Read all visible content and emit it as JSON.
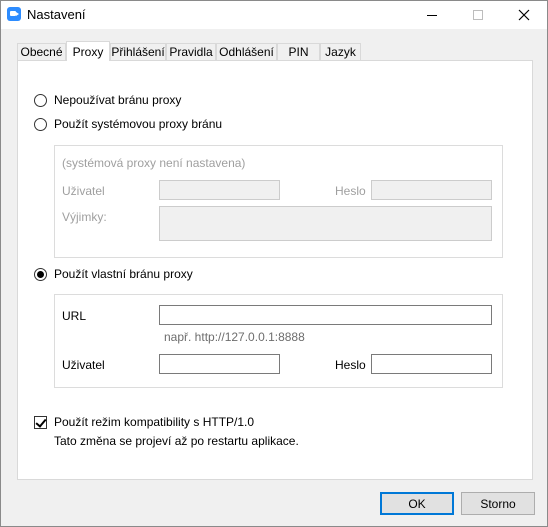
{
  "window": {
    "title": "Nastavení",
    "icon": "zoom-app-icon"
  },
  "tabs": [
    "Obecné",
    "Proxy",
    "Přihlášení",
    "Pravidla",
    "Odhlášení",
    "PIN",
    "Jazyk"
  ],
  "active_tab": "Proxy",
  "proxy": {
    "no_proxy_label": "Nepoužívat bránu proxy",
    "system_proxy_label": "Použít systémovou proxy bránu",
    "system_group": {
      "status": "(systémová proxy není nastavena)",
      "user_label": "Uživatel",
      "password_label": "Heslo",
      "exceptions_label": "Výjimky:"
    },
    "custom_proxy_label": "Použít vlastní bránu proxy",
    "custom_group": {
      "url_label": "URL",
      "url_value": "",
      "url_hint": "např. http://127.0.0.1:8888",
      "user_label": "Uživatel",
      "user_value": "",
      "password_label": "Heslo",
      "password_value": ""
    },
    "selected": "custom",
    "http10_label": "Použít režim kompatibility s HTTP/1.0",
    "http10_checked": true,
    "restart_note": "Tato změna se projeví až po restartu aplikace."
  },
  "buttons": {
    "ok": "OK",
    "cancel": "Storno"
  },
  "colors": {
    "accent": "#0078d7",
    "app_icon": "#2d8cff"
  }
}
